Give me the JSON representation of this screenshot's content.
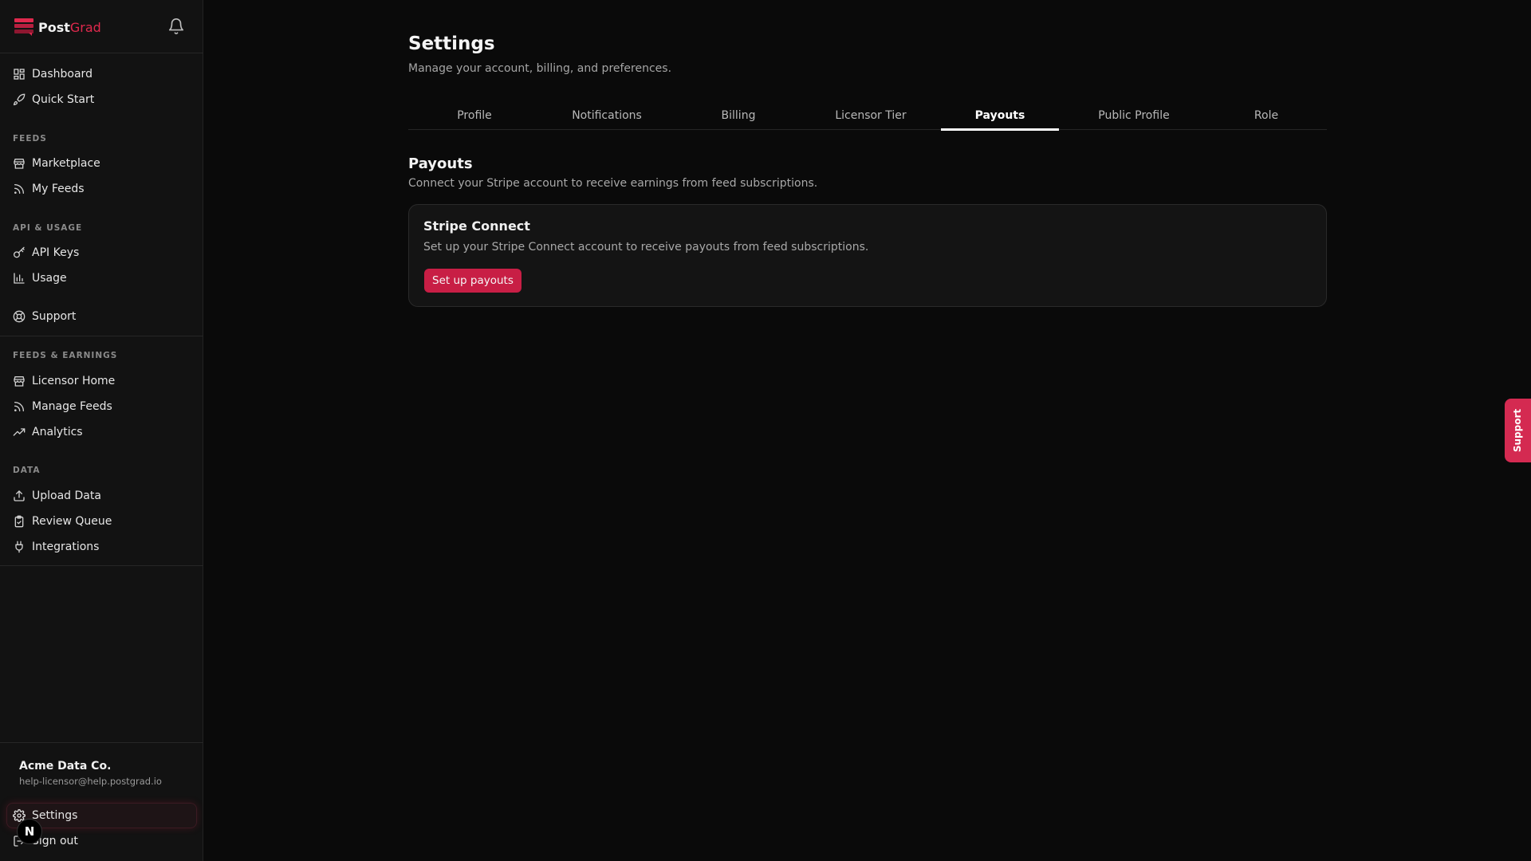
{
  "brand": {
    "post": "Post",
    "grad": "Grad"
  },
  "sidebar": {
    "top_items": [
      {
        "label": "Dashboard",
        "icon": "dashboard-icon"
      },
      {
        "label": "Quick Start",
        "icon": "rocket-icon"
      }
    ],
    "sections": [
      {
        "title": "FEEDS",
        "items": [
          {
            "label": "Marketplace",
            "icon": "store-icon"
          },
          {
            "label": "My Feeds",
            "icon": "rss-icon"
          }
        ]
      },
      {
        "title": "API & USAGE",
        "items": [
          {
            "label": "API Keys",
            "icon": "key-icon"
          },
          {
            "label": "Usage",
            "icon": "bar-chart-icon"
          }
        ]
      },
      {
        "title": "",
        "items": [
          {
            "label": "Support",
            "icon": "lifebuoy-icon"
          }
        ]
      },
      {
        "title": "FEEDS & EARNINGS",
        "items": [
          {
            "label": "Licensor Home",
            "icon": "store-icon"
          },
          {
            "label": "Manage Feeds",
            "icon": "rss-icon"
          },
          {
            "label": "Analytics",
            "icon": "trending-up-icon"
          }
        ]
      },
      {
        "title": "DATA",
        "items": [
          {
            "label": "Upload Data",
            "icon": "upload-icon"
          },
          {
            "label": "Review Queue",
            "icon": "clipboard-check-icon"
          },
          {
            "label": "Integrations",
            "icon": "plug-icon"
          }
        ]
      }
    ],
    "user": {
      "name": "Acme Data Co.",
      "email": "help-licensor@help.postgrad.io"
    },
    "settings_label": "Settings",
    "signout_label": "Sign out",
    "avatar_letter": "N"
  },
  "page": {
    "title": "Settings",
    "subtitle": "Manage your account, billing, and preferences.",
    "tabs": [
      {
        "label": "Profile",
        "active": false
      },
      {
        "label": "Notifications",
        "active": false
      },
      {
        "label": "Billing",
        "active": false
      },
      {
        "label": "Licensor Tier",
        "active": false
      },
      {
        "label": "Payouts",
        "active": true
      },
      {
        "label": "Public Profile",
        "active": false
      },
      {
        "label": "Role",
        "active": false
      }
    ],
    "section_title": "Payouts",
    "section_subtitle": "Connect your Stripe account to receive earnings from feed subscriptions.",
    "card": {
      "title": "Stripe Connect",
      "subtitle": "Set up your Stripe Connect account to receive payouts from feed subscriptions.",
      "button": "Set up payouts"
    }
  },
  "support_tab": "Support",
  "colors": {
    "accent": "#c81e45",
    "support": "#d42a51",
    "brand_red": "#e0294d"
  }
}
